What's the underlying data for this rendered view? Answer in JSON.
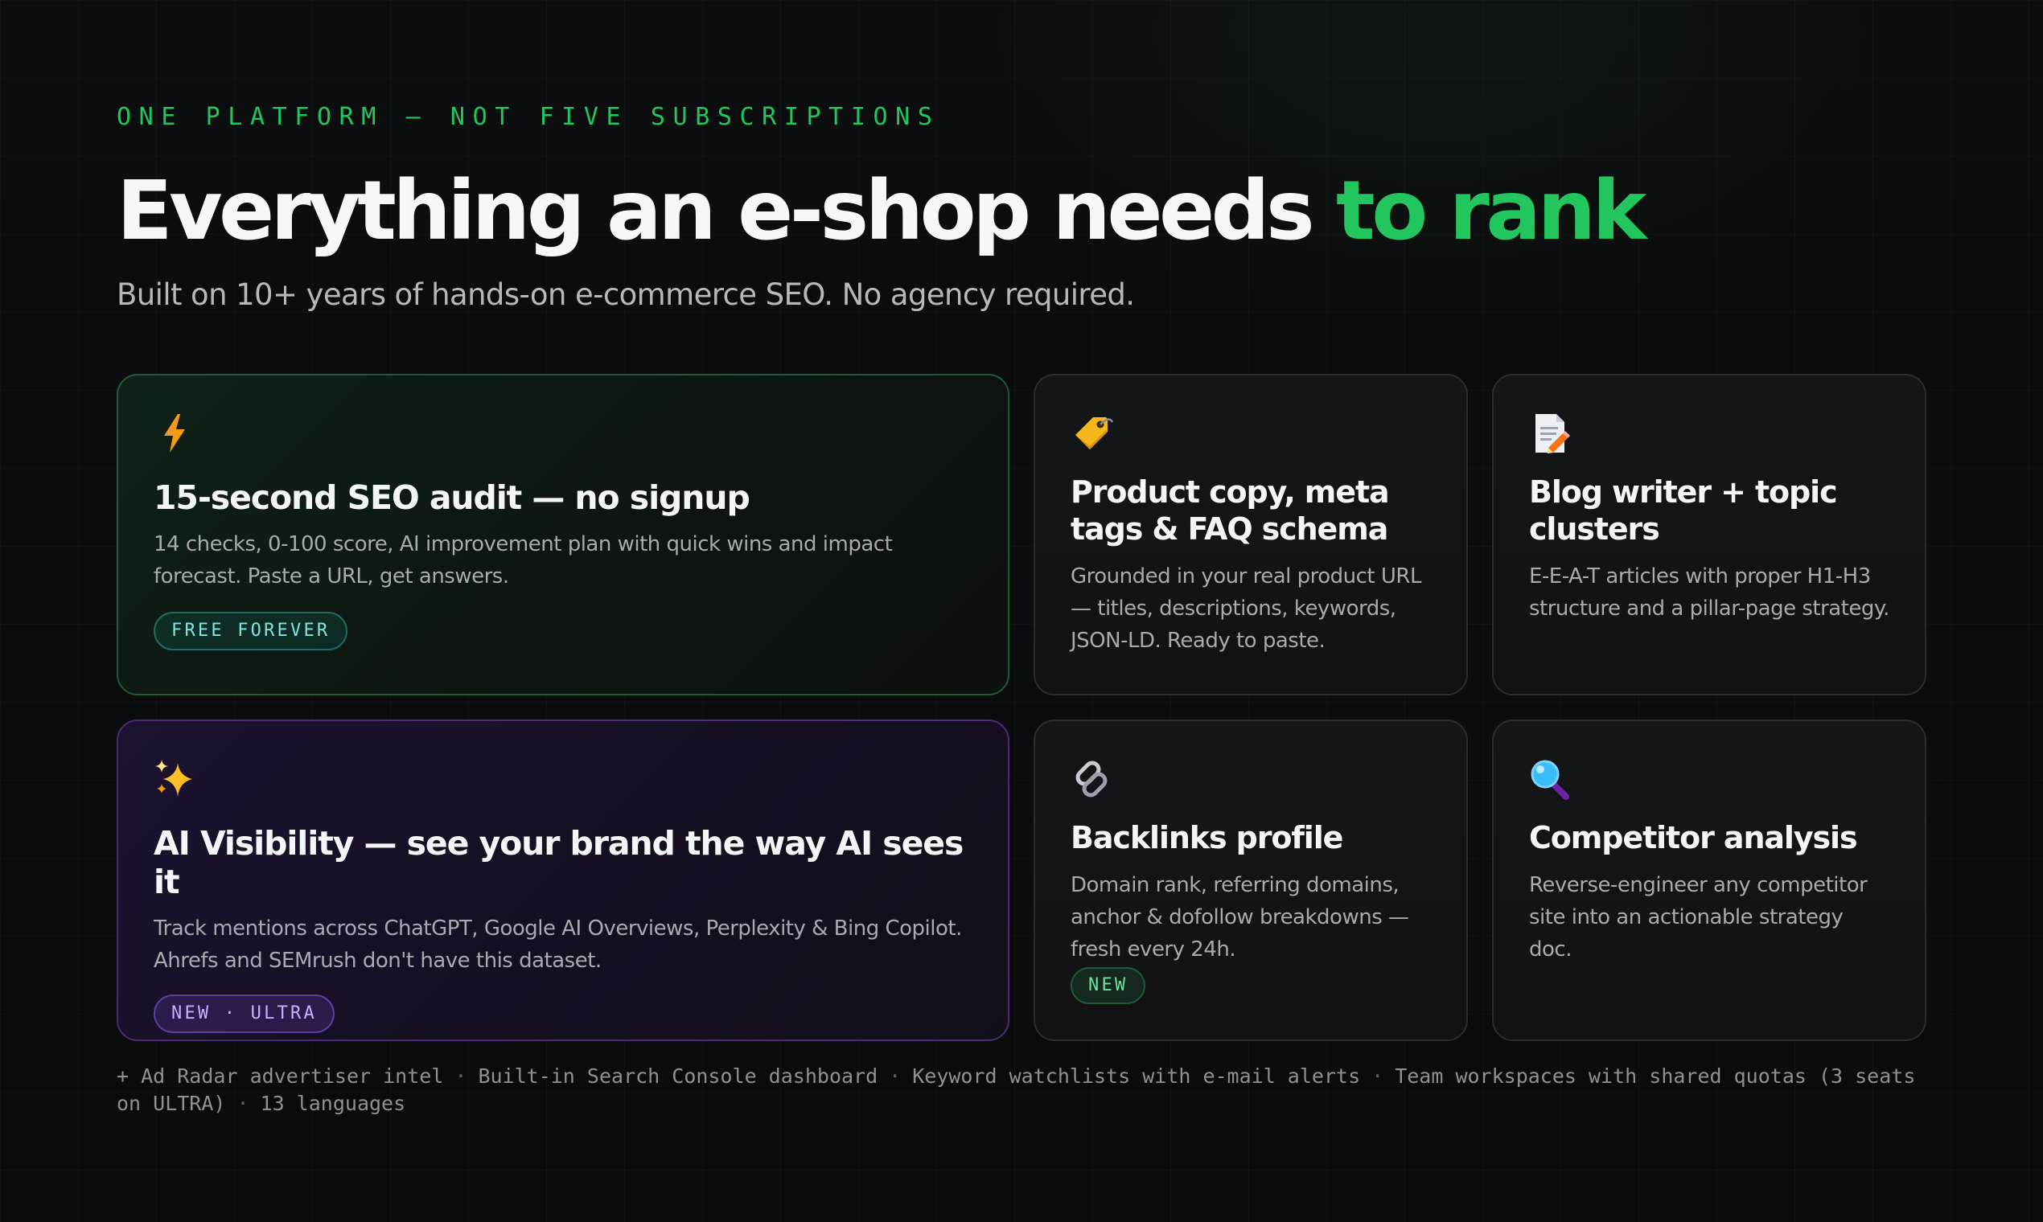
{
  "section": {
    "eyebrow": "ONE PLATFORM — NOT FIVE SUBSCRIPTIONS",
    "headline_main": "Everything an e-shop needs",
    "headline_accent": "to rank",
    "subtitle": "Built on 10+ years of hands-on e-commerce SEO. No agency required."
  },
  "cards": {
    "audit": {
      "icon": "lightning-icon",
      "title": "15-second SEO audit — no signup",
      "desc": "14 checks, 0-100 score, AI improvement plan with quick wins and impact forecast. Paste a URL, get answers.",
      "badge": "FREE FOREVER"
    },
    "product": {
      "icon": "tag-icon",
      "title": "Product copy, meta tags & FAQ schema",
      "desc": "Grounded in your real product URL — titles, descriptions, keywords, JSON-LD. Ready to paste."
    },
    "blog": {
      "icon": "document-pencil-icon",
      "title": "Blog writer + topic clusters",
      "desc": "E-E-A-T articles with proper H1-H3 structure and a pillar-page strategy."
    },
    "ai": {
      "icon": "sparkles-icon",
      "title": "AI Visibility — see your brand the way AI sees it",
      "desc": "Track mentions across ChatGPT, Google AI Overviews, Perplexity & Bing Copilot. Ahrefs and SEMrush don't have this dataset.",
      "badge": "NEW · ULTRA"
    },
    "backlinks": {
      "icon": "link-icon",
      "title": "Backlinks profile",
      "desc": "Domain rank, referring domains, anchor & dofollow breakdowns — fresh every 24h.",
      "badge": "NEW"
    },
    "competitor": {
      "icon": "magnifier-icon",
      "title": "Competitor analysis",
      "desc": "Reverse-engineer any competitor site into an actionable strategy doc."
    }
  },
  "footer": {
    "items": [
      "+ Ad Radar advertiser intel",
      "Built-in Search Console dashboard",
      "Keyword watchlists with e-mail alerts",
      "Team workspaces with shared quotas (3 seats on ULTRA)",
      "13 languages"
    ],
    "separator": "·"
  },
  "colors": {
    "accent_green": "#22c55e",
    "background": "#0b0c0d",
    "free_badge": "#7fe5e0",
    "ultra_badge": "#c4b1ff",
    "new_badge": "#6fe0a0"
  }
}
